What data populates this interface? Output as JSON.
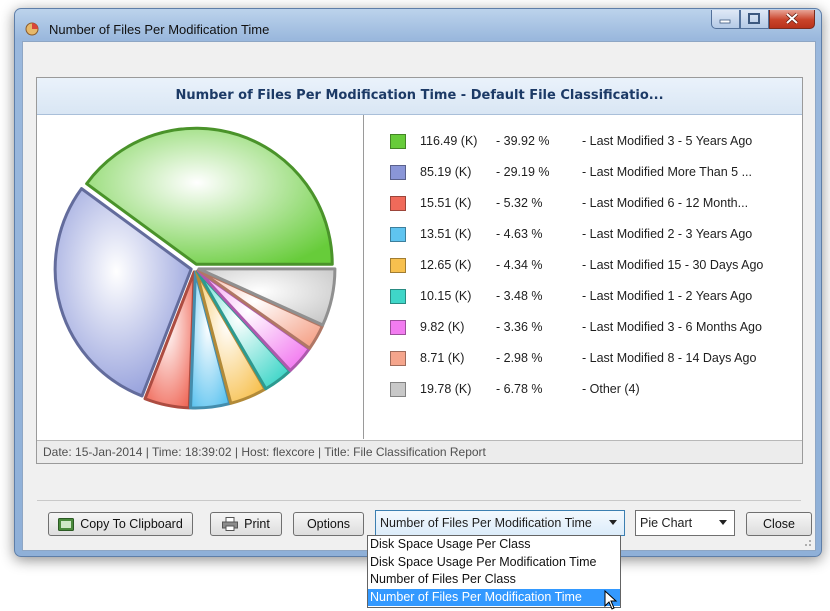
{
  "window": {
    "title": "Number of Files Per Modification Time"
  },
  "chart_panel": {
    "title": "Number of Files Per Modification Time - Default File Classificatio...",
    "footer": "Date: 15-Jan-2014 | Time: 18:39:02 | Host: flexcore | Title: File Classification Report"
  },
  "chart_data": {
    "type": "pie",
    "title": "Number of Files Per Modification Time - Default File Classificatio...",
    "slices": [
      {
        "value_label": "116.49 (K)",
        "value": 116.49,
        "percent": 39.92,
        "percent_label": "- 39.92 %",
        "label": "- Last Modified 3 - 5 Years Ago",
        "color": "#67cc3a"
      },
      {
        "value_label": "85.19 (K)",
        "value": 85.19,
        "percent": 29.19,
        "percent_label": "- 29.19 %",
        "label": "- Last Modified More Than 5 ...",
        "color": "#8a96d8"
      },
      {
        "value_label": "15.51 (K)",
        "value": 15.51,
        "percent": 5.32,
        "percent_label": "- 5.32 %",
        "label": "- Last Modified 6 - 12 Month...",
        "color": "#f06a5a"
      },
      {
        "value_label": "13.51 (K)",
        "value": 13.51,
        "percent": 4.63,
        "percent_label": "- 4.63 %",
        "label": "- Last Modified 2 - 3 Years Ago",
        "color": "#5fc4f0"
      },
      {
        "value_label": "12.65 (K)",
        "value": 12.65,
        "percent": 4.34,
        "percent_label": "- 4.34 %",
        "label": "- Last Modified 15 - 30 Days Ago",
        "color": "#f7c04e"
      },
      {
        "value_label": "10.15 (K)",
        "value": 10.15,
        "percent": 3.48,
        "percent_label": "- 3.48 %",
        "label": "- Last Modified 1 - 2 Years Ago",
        "color": "#3fd6c8"
      },
      {
        "value_label": "9.82 (K)",
        "value": 9.82,
        "percent": 3.36,
        "percent_label": "- 3.36 %",
        "label": "- Last Modified 3 - 6 Months Ago",
        "color": "#f27cf0"
      },
      {
        "value_label": "8.71 (K)",
        "value": 8.71,
        "percent": 2.98,
        "percent_label": "- 2.98 %",
        "label": "- Last Modified 8 - 14 Days Ago",
        "color": "#f5a58c"
      },
      {
        "value_label": "19.78 (K)",
        "value": 19.78,
        "percent": 6.78,
        "percent_label": "- 6.78 %",
        "label": "- Other (4)",
        "color": "#c8c8c8"
      }
    ],
    "start_angle_deg": 0,
    "direction": "counter-clockwise",
    "legend_position": "right"
  },
  "buttons": {
    "copy": "Copy To Clipboard",
    "print": "Print",
    "options": "Options",
    "close": "Close"
  },
  "icons": {
    "window": "pie-app-icon",
    "copy": "clipboard-icon",
    "print": "printer-icon"
  },
  "report_select": {
    "value": "Number of Files Per Modification Time",
    "options": [
      "Disk Space Usage Per Class",
      "Disk Space Usage Per Modification Time",
      "Number of Files Per Class",
      "Number of Files Per Modification Time"
    ],
    "selected_index": 3
  },
  "chart_type_select": {
    "value": "Pie Chart"
  }
}
